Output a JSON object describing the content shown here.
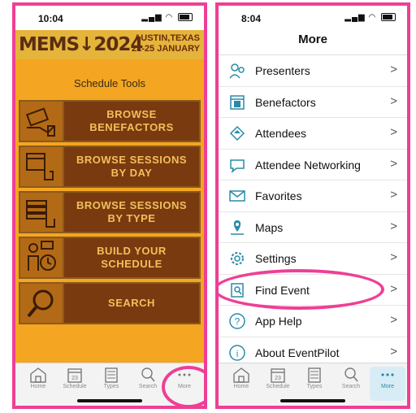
{
  "left_phone": {
    "status_time": "10:04",
    "banner_logo": "MEMS↓2024",
    "banner_place_line1": "AUSTIN,TEXAS",
    "banner_place_line2": "21-25 JANUARY",
    "tools_title": "Schedule Tools",
    "tiles": [
      {
        "label": "BROWSE\nBENEFACTORS",
        "icon": "money-hand-icon"
      },
      {
        "label": "BROWSE SESSIONS\nBY DAY",
        "icon": "calendar-hand-icon"
      },
      {
        "label": "BROWSE SESSIONS\nBY TYPE",
        "icon": "books-hand-icon"
      },
      {
        "label": "BUILD YOUR\nSCHEDULE",
        "icon": "person-clock-icon"
      },
      {
        "label": "SEARCH",
        "icon": "magnifier-icon"
      }
    ],
    "tabs": [
      {
        "label": "Home",
        "icon": "home-icon"
      },
      {
        "label": "Schedule",
        "icon": "calendar-icon"
      },
      {
        "label": "Types",
        "icon": "list-icon"
      },
      {
        "label": "Search",
        "icon": "search-icon"
      },
      {
        "label": "More",
        "icon": "more-icon"
      }
    ],
    "calendar_day": "23"
  },
  "right_phone": {
    "status_time": "8:04",
    "nav_title": "More",
    "menu": [
      {
        "label": "Presenters",
        "icon": "presenters-icon"
      },
      {
        "label": "Benefactors",
        "icon": "benefactors-icon"
      },
      {
        "label": "Attendees",
        "icon": "attendees-icon"
      },
      {
        "label": "Attendee Networking",
        "icon": "chat-icon"
      },
      {
        "label": "Favorites",
        "icon": "envelope-icon"
      },
      {
        "label": "Maps",
        "icon": "map-pin-icon"
      },
      {
        "label": "Settings",
        "icon": "gear-icon"
      },
      {
        "label": "Find Event",
        "icon": "find-event-icon"
      },
      {
        "label": "App Help",
        "icon": "help-icon"
      },
      {
        "label": "About EventPilot",
        "icon": "info-icon"
      }
    ],
    "chevron": ">",
    "tabs": [
      {
        "label": "Home",
        "icon": "home-icon"
      },
      {
        "label": "Schedule",
        "icon": "calendar-icon"
      },
      {
        "label": "Types",
        "icon": "list-icon"
      },
      {
        "label": "Search",
        "icon": "search-icon"
      },
      {
        "label": "More",
        "icon": "more-icon"
      }
    ],
    "calendar_day": "23"
  },
  "colors": {
    "highlight": "#ee3f95",
    "banner": "#e5b43a",
    "tools_bg": "#f4a521",
    "tile_text_bg": "#7a3a10",
    "tile_text": "#f1c05a",
    "icon_teal": "#2a8aa8",
    "active_tab": "#d8ecf6"
  }
}
